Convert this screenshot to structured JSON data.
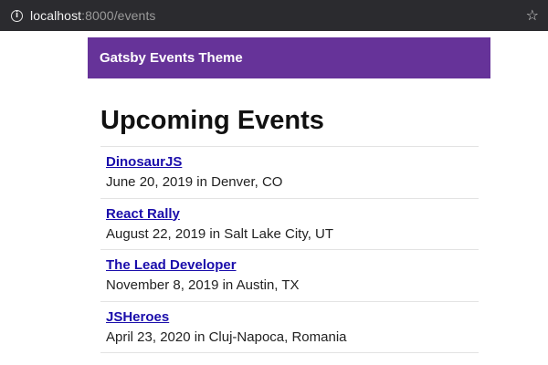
{
  "browser": {
    "url_host": "localhost",
    "url_rest": ":8000/events",
    "info_icon": "info-icon",
    "bookmark_icon": "star-icon"
  },
  "header": {
    "site_title": "Gatsby Events Theme",
    "background_color": "#663399"
  },
  "main": {
    "page_title": "Upcoming Events",
    "events": [
      {
        "name": "DinosaurJS",
        "date": "June 20, 2019",
        "location": "Denver, CO"
      },
      {
        "name": "React Rally",
        "date": "August 22, 2019",
        "location": "Salt Lake City, UT"
      },
      {
        "name": "The Lead Developer",
        "date": "November 8, 2019",
        "location": "Austin, TX"
      },
      {
        "name": "JSHeroes",
        "date": "April 23, 2020",
        "location": "Cluj-Napoca, Romania"
      }
    ]
  }
}
